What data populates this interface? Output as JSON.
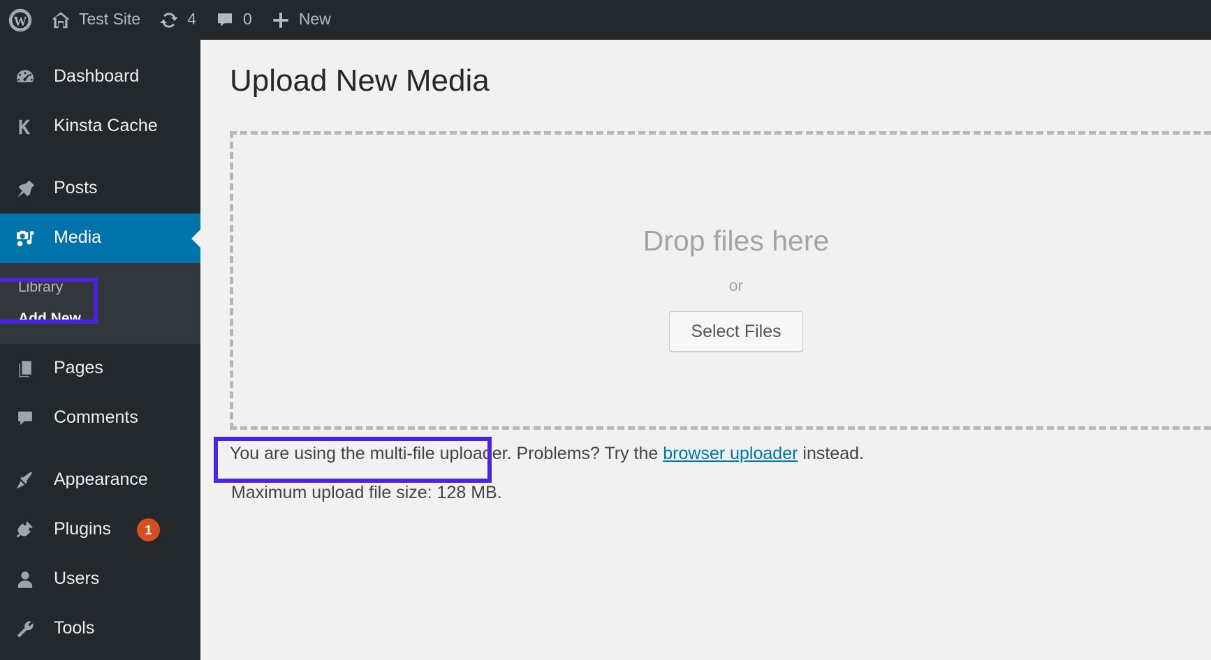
{
  "adminbar": {
    "wp_logo": "wordpress-logo",
    "site_name": "Test Site",
    "updates_count": "4",
    "comments_count": "0",
    "new_label": "New"
  },
  "sidebar": {
    "items": [
      {
        "label": "Dashboard",
        "icon": "dashboard-icon",
        "current": false
      },
      {
        "label": "Kinsta Cache",
        "icon": "kinsta-icon",
        "current": false
      },
      {
        "label": "Posts",
        "icon": "pin-icon",
        "current": false
      },
      {
        "label": "Media",
        "icon": "media-icon",
        "current": true
      },
      {
        "label": "Pages",
        "icon": "pages-icon",
        "current": false
      },
      {
        "label": "Comments",
        "icon": "comments-icon",
        "current": false
      },
      {
        "label": "Appearance",
        "icon": "appearance-icon",
        "current": false
      },
      {
        "label": "Plugins",
        "icon": "plugins-icon",
        "current": false,
        "badge": "1"
      },
      {
        "label": "Users",
        "icon": "users-icon",
        "current": false
      },
      {
        "label": "Tools",
        "icon": "tools-icon",
        "current": false
      }
    ],
    "submenu": [
      {
        "label": "Library",
        "current": false
      },
      {
        "label": "Add New",
        "current": true
      }
    ]
  },
  "main": {
    "page_title": "Upload New Media",
    "dropzone": {
      "drop_text": "Drop files here",
      "or_text": "or",
      "select_button": "Select Files"
    },
    "uploader_note_pre": "You are using the multi-file uploader. Problems? Try the ",
    "uploader_note_link": "browser uploader",
    "uploader_note_post": " instead.",
    "max_upload": "Maximum upload file size: 128 MB."
  },
  "annotations": {
    "highlight_color": "#4b24e0",
    "boxes": [
      "add-new-sidebar-item",
      "maximum-upload-file-size"
    ]
  },
  "colors": {
    "admin_bar_bg": "#23282d",
    "sidebar_bg": "#23282d",
    "submenu_bg": "#32373c",
    "current_item_bg": "#0073aa",
    "content_bg": "#f1f1f1",
    "link": "#0073aa",
    "badge_bg": "#d54e21",
    "dashed_border": "#b4b9be"
  }
}
